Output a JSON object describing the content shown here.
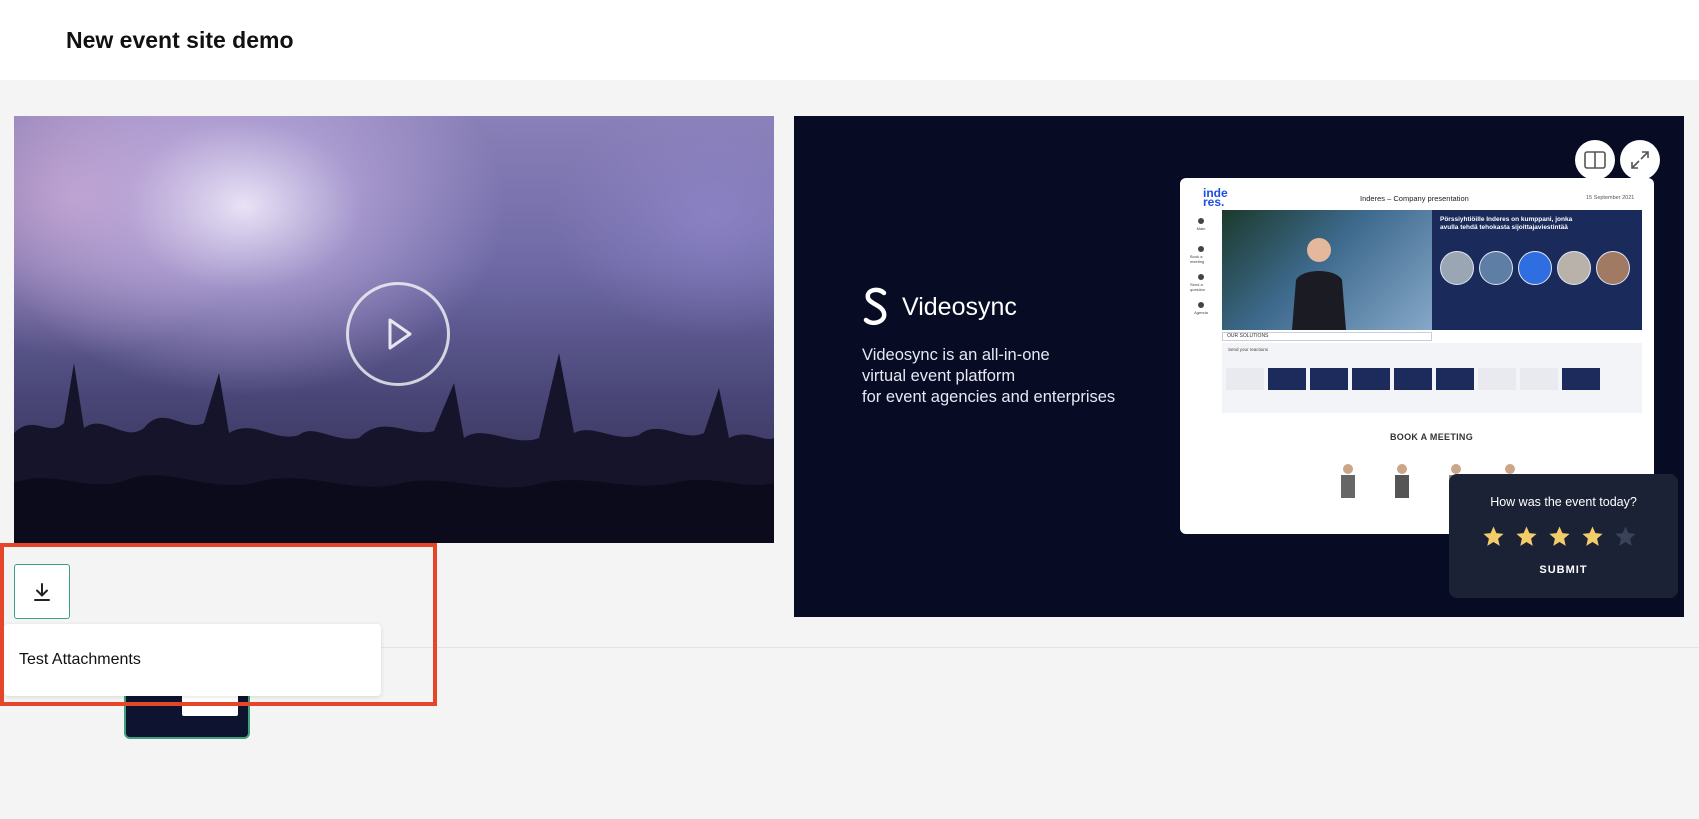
{
  "header": {
    "title": "New event site demo"
  },
  "video": {
    "play_icon": "play-icon"
  },
  "presentation": {
    "brand": "Videosync",
    "tagline_lines": [
      "Videosync is an all-in-one",
      "virtual event platform",
      "for event agencies and enterprises"
    ],
    "controls": {
      "split_icon": "split-view-icon",
      "fullscreen_icon": "fullscreen-icon"
    },
    "screenshot": {
      "logo": "inde res.",
      "title": "Inderes – Company presentation",
      "date": "15 September 2021",
      "sidebar": [
        "Main",
        "Book a meeting",
        "Send a question",
        "Agenda"
      ],
      "banner_title": "Pörssiyhtiöille Inderes on kumppani, jonka avulla tehdä tehokasta sijoittajaviestintää",
      "solutions_label": "OUR SOLUTIONS",
      "reactions_label": "Send your reactions",
      "book_title": "BOOK A MEETING"
    }
  },
  "rating": {
    "question": "How was the event today?",
    "stars_total": 5,
    "stars_selected": 4,
    "submit_label": "SUBMIT",
    "colors": {
      "filled": "#f3cd6a",
      "empty": "#3a4258"
    }
  },
  "attachments": {
    "download_icon": "download-icon",
    "label": "Test Attachments"
  },
  "colors": {
    "accent_green": "#3aa37a",
    "highlight": "#e5462a",
    "presentation_bg": "#070b24"
  }
}
